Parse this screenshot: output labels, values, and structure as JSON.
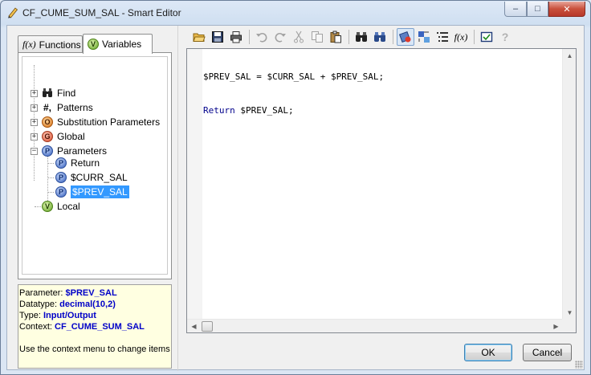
{
  "window": {
    "title": "CF_CUME_SUM_SAL - Smart Editor",
    "controls": {
      "minimize": "‒",
      "maximize": "□",
      "close": "✕"
    }
  },
  "tabs": [
    {
      "label": "Functions",
      "icon": "fx",
      "active": false
    },
    {
      "label": "Variables",
      "icon": "V",
      "active": true
    }
  ],
  "tree": {
    "items": [
      {
        "label": "Find",
        "icon": "binoculars-icon",
        "glyph": "⛶",
        "expander": "+"
      },
      {
        "label": "Patterns",
        "icon": "pattern-icon",
        "glyph": "#,",
        "expander": "+"
      },
      {
        "label": "Substitution Parameters",
        "icon": "O",
        "expander": "+"
      },
      {
        "label": "Global",
        "icon": "G",
        "expander": "+"
      },
      {
        "label": "Parameters",
        "icon": "P",
        "expander": "−"
      },
      {
        "label": "Return",
        "icon": "P"
      },
      {
        "label": "$CURR_SAL",
        "icon": "P"
      },
      {
        "label": "$PREV_SAL",
        "icon": "P",
        "selected": true
      },
      {
        "label": "Local",
        "icon": "V"
      }
    ]
  },
  "info": {
    "parameter_label": "Parameter:",
    "parameter_value": "$PREV_SAL",
    "datatype_label": "Datatype:",
    "datatype_value": "decimal(10,2)",
    "type_label": "Type:",
    "type_value": "Input/Output",
    "context_label": "Context:",
    "context_value": "CF_CUME_SUM_SAL",
    "hint": "Use the context menu to change items"
  },
  "toolbar": {
    "buttons": [
      "open-icon",
      "save-icon",
      "print-icon",
      "undo-icon",
      "redo-icon",
      "cut-icon",
      "copy-icon",
      "paste-icon",
      "find-icon",
      "replace-icon",
      "show-variables-icon",
      "show-smart-icon",
      "outline-icon",
      "function-icon",
      "validate-icon",
      "help-icon"
    ]
  },
  "editor": {
    "line1_a": "$PREV_SAL = $CURR_SAL + $PREV_SAL;",
    "line2_kw": "Return",
    "line2_rest": " $PREV_SAL;"
  },
  "buttons": {
    "ok": "OK",
    "cancel": "Cancel"
  },
  "colors": {
    "selection": "#3399ff",
    "info_bg": "#ffffe1",
    "info_value": "#0000c8",
    "keyword": "#00008b"
  }
}
